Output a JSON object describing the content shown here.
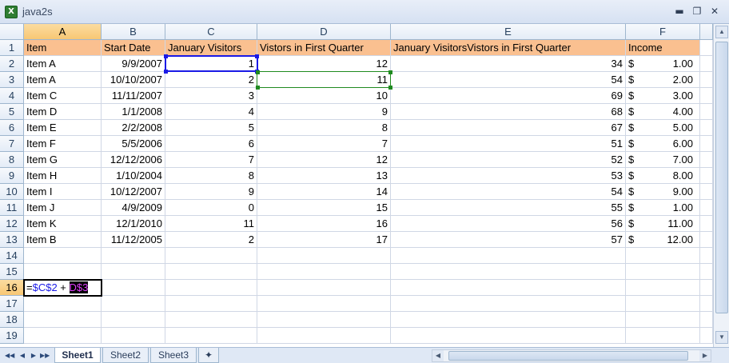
{
  "window": {
    "title": "java2s",
    "icon": "excel-icon",
    "minimize": "▬",
    "restore": "❐",
    "close": "✕"
  },
  "columns": [
    "A",
    "B",
    "C",
    "D",
    "E",
    "F"
  ],
  "rows": [
    [
      "Item",
      "Start Date",
      "January Visitors",
      "Vistors in First Quarter",
      "January VisitorsVistors in First Quarter",
      "Income"
    ],
    [
      "Item A",
      "9/9/2007",
      "1",
      "12",
      "34",
      "$|1.00"
    ],
    [
      "Item A",
      "10/10/2007",
      "2",
      "11",
      "54",
      "$|2.00"
    ],
    [
      "Item C",
      "11/11/2007",
      "3",
      "10",
      "69",
      "$|3.00"
    ],
    [
      "Item D",
      "1/1/2008",
      "4",
      "9",
      "68",
      "$|4.00"
    ],
    [
      "Item E",
      "2/2/2008",
      "5",
      "8",
      "67",
      "$|5.00"
    ],
    [
      "Item F",
      "5/5/2006",
      "6",
      "7",
      "51",
      "$|6.00"
    ],
    [
      "Item G",
      "12/12/2006",
      "7",
      "12",
      "52",
      "$|7.00"
    ],
    [
      "Item H",
      "1/10/2004",
      "8",
      "13",
      "53",
      "$|8.00"
    ],
    [
      "Item I",
      "10/12/2007",
      "9",
      "14",
      "54",
      "$|9.00"
    ],
    [
      "Item J",
      "4/9/2009",
      "0",
      "15",
      "55",
      "$|1.00"
    ],
    [
      "Item K",
      "12/1/2010",
      "11",
      "16",
      "56",
      "$|11.00"
    ],
    [
      "Item B",
      "11/12/2005",
      "2",
      "17",
      "57",
      "$|12.00"
    ]
  ],
  "row_numbers": [
    "1",
    "2",
    "3",
    "4",
    "5",
    "6",
    "7",
    "8",
    "9",
    "10",
    "11",
    "12",
    "13",
    "14",
    "15",
    "16",
    "17",
    "18",
    "19"
  ],
  "editing": {
    "cell": "A16",
    "prefix": "=",
    "ref1": "$C$2",
    "op": " + ",
    "ref2": "D$3",
    "active_row": "16",
    "active_col": "A"
  },
  "sheets": [
    "Sheet1",
    "Sheet2",
    "Sheet3"
  ],
  "active_sheet": "Sheet1",
  "nav_glyphs": [
    "◀◀",
    "◀",
    "▶",
    "▶▶"
  ],
  "colors": {
    "header_fill": "#fac090",
    "ref_blue": "#1a1ae6",
    "ref_green": "#1f8a1f",
    "ref_magenta": "#e040fb"
  }
}
